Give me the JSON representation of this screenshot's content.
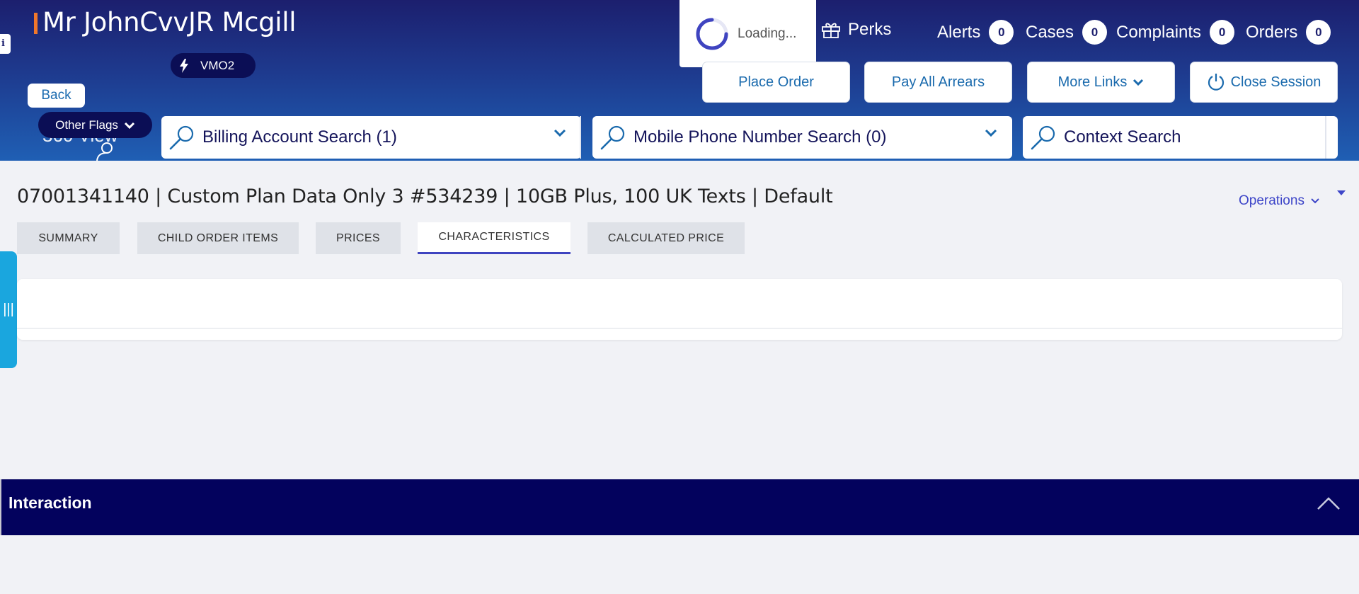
{
  "header": {
    "info_tab": "i",
    "customer_name": "Mr JohnCvvJR Mcgill",
    "brand_badge": "VMO2",
    "back_label": "Back",
    "view360_label": "360 View",
    "other_flags_label": "Other Flags",
    "loading_text": "Loading...",
    "perks_label": "Perks",
    "counters": [
      {
        "label": "Alerts",
        "count": "0"
      },
      {
        "label": "Cases",
        "count": "0"
      },
      {
        "label": "Complaints",
        "count": "0"
      },
      {
        "label": "Orders",
        "count": "0"
      }
    ],
    "actions": {
      "place_order": "Place Order",
      "pay_all_arrears": "Pay All Arrears",
      "more_links": "More Links",
      "close_session": "Close Session"
    },
    "searches": {
      "billing": "Billing Account Search (1)",
      "mobile": "Mobile Phone Number Search (0)",
      "context": "Context Search"
    }
  },
  "main": {
    "item_title": "07001341140 | Custom Plan Data Only 3 #534239 | 10GB Plus, 100 UK Texts | Default",
    "operations_label": "Operations",
    "tabs": [
      {
        "label": "SUMMARY",
        "active": false
      },
      {
        "label": "CHILD ORDER ITEMS",
        "active": false
      },
      {
        "label": "PRICES",
        "active": false
      },
      {
        "label": "CHARACTERISTICS",
        "active": true
      },
      {
        "label": "CALCULATED PRICE",
        "active": false
      }
    ],
    "side_tab_glyph": "|||"
  },
  "interaction": {
    "title": "Interaction"
  },
  "colors": {
    "header_dark": "#1c1f6e",
    "header_light": "#1f5fb4",
    "badge_bg": "#0b0e55",
    "accent_link": "#1a6aad",
    "active_tab_underline": "#3f44c0",
    "side_tab": "#1aa6de",
    "interaction_bar": "#03025d",
    "name_marker": "#f0772b"
  },
  "icons": [
    "bolt-icon",
    "chevron-down-icon",
    "spinner-icon",
    "gift-icon",
    "power-icon",
    "search-icon",
    "person-icon",
    "chevron-up-icon"
  ]
}
